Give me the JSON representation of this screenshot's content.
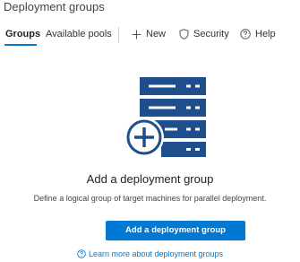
{
  "page": {
    "title": "Deployment groups"
  },
  "tabs": [
    {
      "label": "Groups",
      "selected": true
    },
    {
      "label": "Available pools",
      "selected": false
    }
  ],
  "commands": {
    "new_label": "New",
    "security_label": "Security",
    "help_label": "Help"
  },
  "empty_state": {
    "title": "Add a deployment group",
    "description": "Define a logical group of target machines for parallel deployment.",
    "button_label": "Add a deployment group",
    "learn_more_label": "Learn more about deployment groups"
  },
  "icons": {
    "new": "plus-icon",
    "security": "shield-icon",
    "help": "help-circle-icon",
    "hero": "server-stack-add-icon",
    "learn_more": "help-circle-icon"
  },
  "colors": {
    "accent": "#0078d4",
    "icon_dark": "#1e4e8c",
    "text": "#333333"
  }
}
